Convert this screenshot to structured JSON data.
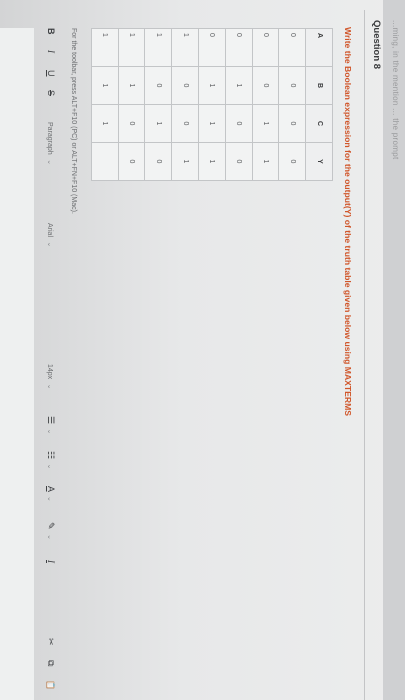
{
  "header_strip": {
    "text": "...ming, in the mention ... the prompt"
  },
  "question": {
    "title": "Question 8",
    "prompt": "Write the Boolean expression for the output(Y) of the truth table given below using MAXTERMS"
  },
  "truth_table": {
    "headers": [
      "A",
      "B",
      "C",
      "Y"
    ],
    "rows": [
      [
        "0",
        "0",
        "0",
        "0"
      ],
      [
        "0",
        "0",
        "1",
        "1"
      ],
      [
        "0",
        "1",
        "0",
        "0"
      ],
      [
        "0",
        "1",
        "1",
        "1"
      ],
      [
        "1",
        "0",
        "0",
        "1"
      ],
      [
        "1",
        "0",
        "1",
        "0"
      ],
      [
        "1",
        "1",
        "0",
        "0"
      ],
      [
        "1",
        "1",
        "1",
        ""
      ]
    ]
  },
  "editor": {
    "toolbar_hint": "For the toolbar, press ALT+F10 (PC) or ALT+FN+F10 (Mac).",
    "toolbar": {
      "bold": "B",
      "italic": "I",
      "underline": "U",
      "strikethrough": "S",
      "paragraph": "Paragraph",
      "font": "Arial",
      "size": "14px",
      "bullet_list": "☰",
      "numbered_list": "☷",
      "text_color": "A",
      "highlight": "✎",
      "clear_format": "I",
      "cut": "✂",
      "copy": "⧉",
      "paste": "📋"
    }
  },
  "colors": {
    "prompt": "#d0562a",
    "table_border": "#c3c5c7"
  }
}
